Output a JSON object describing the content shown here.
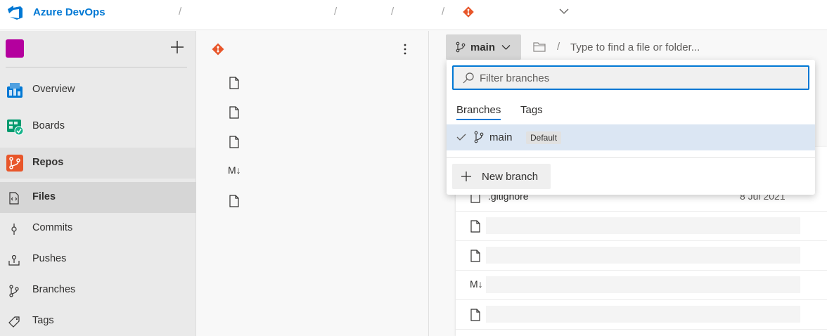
{
  "header": {
    "brand": "Azure DevOps",
    "breadcrumb_separator": "/"
  },
  "leftnav": {
    "add_label": "+",
    "project_color": "#b4009e",
    "items": [
      {
        "label": "Overview",
        "icon": "overview-icon"
      },
      {
        "label": "Boards",
        "icon": "boards-icon"
      },
      {
        "label": "Repos",
        "icon": "repos-icon"
      },
      {
        "label": "Files",
        "icon": "files-icon"
      },
      {
        "label": "Commits",
        "icon": "commits-icon"
      },
      {
        "label": "Pushes",
        "icon": "pushes-icon"
      },
      {
        "label": "Branches",
        "icon": "branches-icon"
      },
      {
        "label": "Tags",
        "icon": "tags-icon"
      }
    ]
  },
  "tree": {
    "markdown_glyph": "M↓"
  },
  "toolbar": {
    "branch_label": "main",
    "path_separator": "/",
    "path_placeholder": "Type to find a file or folder..."
  },
  "dropdown": {
    "filter_placeholder": "Filter branches",
    "tabs": [
      "Branches",
      "Tags"
    ],
    "branch": {
      "name": "main",
      "badge": "Default"
    },
    "new_branch_label": "New branch"
  },
  "files": {
    "rows": [
      {
        "name": ".gitignore",
        "date": "8 Jul 2021"
      }
    ],
    "markdown_glyph": "M↓"
  },
  "colors": {
    "accent": "#0078d4",
    "git_orange": "#e8562a",
    "selection": "#dbe6f3"
  }
}
